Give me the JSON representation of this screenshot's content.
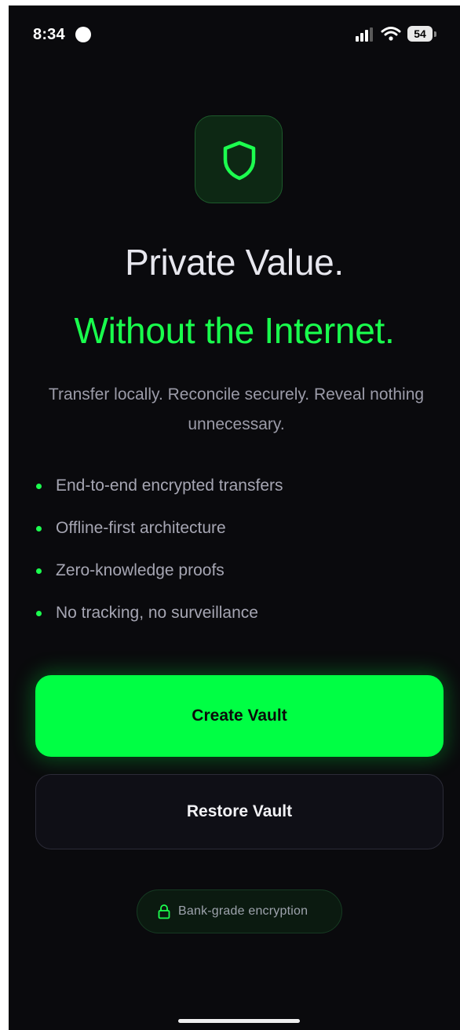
{
  "status_bar": {
    "time": "8:34",
    "battery_level": "54"
  },
  "hero": {
    "icon": "shield-icon",
    "title": "Private Value.",
    "subtitle": "Without the Internet.",
    "tagline": "Transfer locally. Reconcile securely. Reveal nothing unnecessary."
  },
  "features": [
    "End-to-end encrypted transfers",
    "Offline-first architecture",
    "Zero-knowledge proofs",
    "No tracking, no surveillance"
  ],
  "actions": {
    "create_label": "Create Vault",
    "restore_label": "Restore Vault"
  },
  "badge": {
    "icon": "lock-icon",
    "label": "Bank-grade encryption"
  },
  "colors": {
    "background": "#0a0a0d",
    "accent": "#00ff44",
    "text_primary": "#e7e7ee",
    "text_secondary": "#9b9ba8"
  }
}
